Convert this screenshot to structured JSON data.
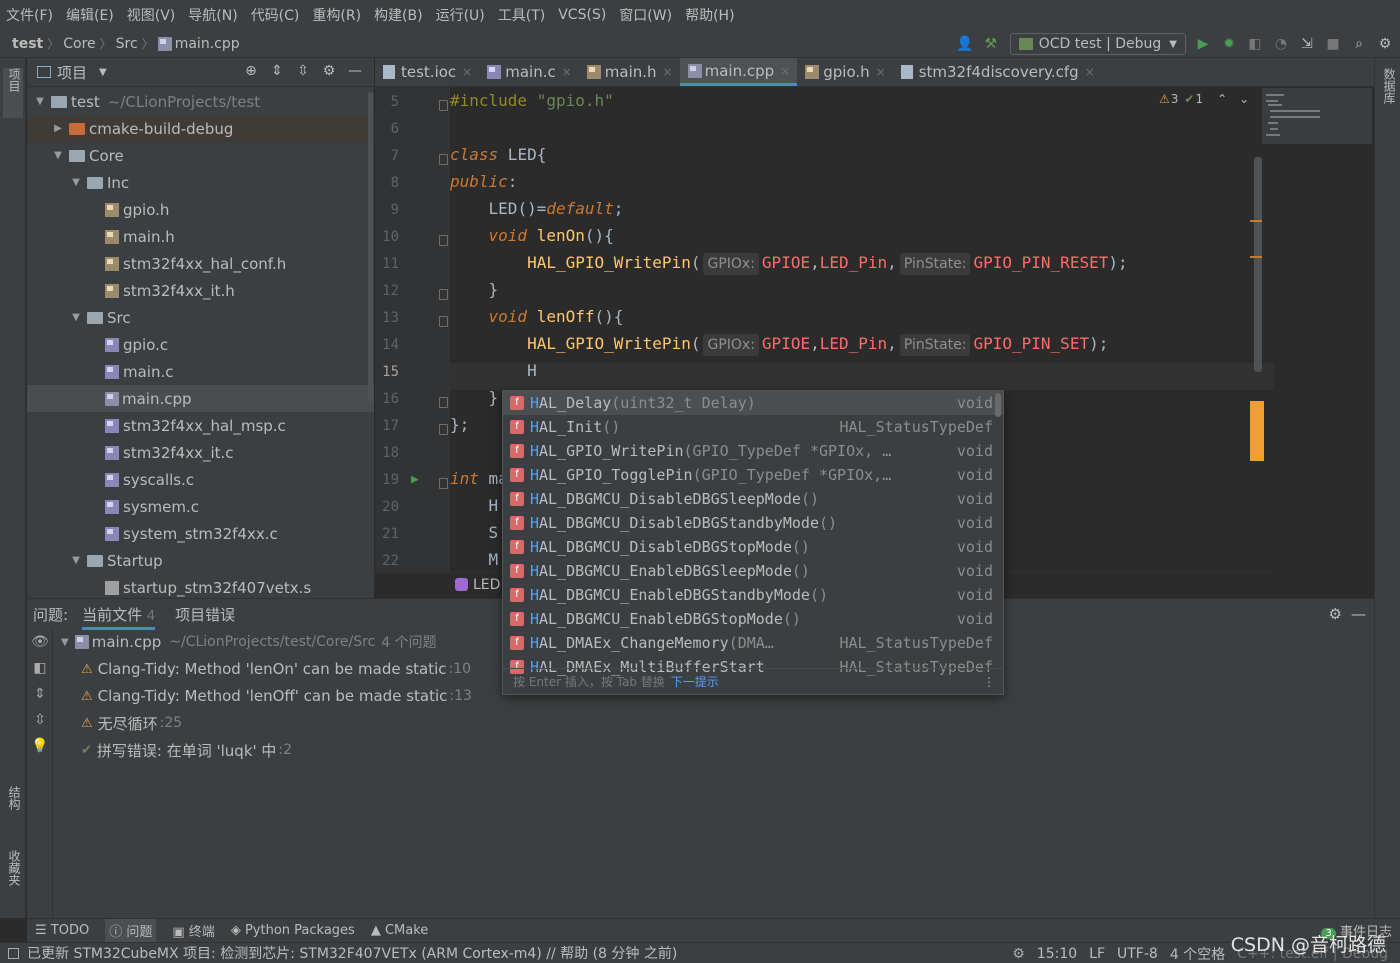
{
  "menu": [
    "文件(F)",
    "编辑(E)",
    "视图(V)",
    "导航(N)",
    "代码(C)",
    "重构(R)",
    "构建(B)",
    "运行(U)",
    "工具(T)",
    "VCS(S)",
    "窗口(W)",
    "帮助(H)"
  ],
  "breadcrumb": [
    "test",
    "Core",
    "Src",
    "main.cpp"
  ],
  "run_config": "OCD test | Debug",
  "left_tabs": [
    "项目",
    "结构",
    "收藏夹"
  ],
  "right_tabs": [
    "数据库"
  ],
  "project_panel": {
    "title": "项目",
    "tree": [
      {
        "label": "test",
        "path": "~/CLionProjects/test",
        "indent": 0,
        "arrow": "▼",
        "icon": "folder"
      },
      {
        "label": "cmake-build-debug",
        "indent": 1,
        "arrow": "▶",
        "icon": "folder-orange"
      },
      {
        "label": "Core",
        "indent": 1,
        "arrow": "▼",
        "icon": "folder"
      },
      {
        "label": "Inc",
        "indent": 2,
        "arrow": "▼",
        "icon": "folder"
      },
      {
        "label": "gpio.h",
        "indent": 3,
        "icon": "h"
      },
      {
        "label": "main.h",
        "indent": 3,
        "icon": "h"
      },
      {
        "label": "stm32f4xx_hal_conf.h",
        "indent": 3,
        "icon": "h"
      },
      {
        "label": "stm32f4xx_it.h",
        "indent": 3,
        "icon": "h"
      },
      {
        "label": "Src",
        "indent": 2,
        "arrow": "▼",
        "icon": "folder"
      },
      {
        "label": "gpio.c",
        "indent": 3,
        "icon": "c"
      },
      {
        "label": "main.c",
        "indent": 3,
        "icon": "c"
      },
      {
        "label": "main.cpp",
        "indent": 3,
        "icon": "cpp"
      },
      {
        "label": "stm32f4xx_hal_msp.c",
        "indent": 3,
        "icon": "c"
      },
      {
        "label": "stm32f4xx_it.c",
        "indent": 3,
        "icon": "c"
      },
      {
        "label": "syscalls.c",
        "indent": 3,
        "icon": "c"
      },
      {
        "label": "sysmem.c",
        "indent": 3,
        "icon": "c"
      },
      {
        "label": "system_stm32f4xx.c",
        "indent": 3,
        "icon": "c"
      },
      {
        "label": "Startup",
        "indent": 2,
        "arrow": "▼",
        "icon": "folder"
      },
      {
        "label": "startup_stm32f407vetx.s",
        "indent": 3,
        "icon": "s"
      }
    ]
  },
  "tabs": [
    {
      "label": "test.ioc",
      "icon": "cfg"
    },
    {
      "label": "main.c",
      "icon": "c"
    },
    {
      "label": "main.h",
      "icon": "h"
    },
    {
      "label": "main.cpp",
      "icon": "cpp",
      "active": true
    },
    {
      "label": "gpio.h",
      "icon": "h"
    },
    {
      "label": "stm32f4discovery.cfg",
      "icon": "cfg"
    }
  ],
  "editor": {
    "line_numbers": [
      "5",
      "6",
      "7",
      "8",
      "9",
      "10",
      "11",
      "12",
      "13",
      "14",
      "15",
      "16",
      "17",
      "18",
      "19",
      "20",
      "21",
      "22"
    ],
    "lines": {
      "l5_kw": "#include",
      "l5_str": "\"gpio.h\"",
      "l7_kw": "class",
      "l7_rest": " LED{",
      "l8_kw": "public",
      "l9_a": "LED",
      "l9_b": "()=",
      "l9_kw": "default",
      "l10_kw": "void",
      "l10_fn": "lenOn",
      "l11_fn": "HAL_GPIO_WritePin",
      "l11_h1": "GPIOx:",
      "l11_a1": "GPIOE",
      "l11_a2": "LED_Pin",
      "l11_h2": "PinState:",
      "l11_a3": "GPIO_PIN_RESET",
      "l13_kw": "void",
      "l13_fn": "lenOff",
      "l14_fn": "HAL_GPIO_WritePin",
      "l14_h1": "GPIOx:",
      "l14_a1": "GPIOE",
      "l14_a2": "LED_Pin",
      "l14_h2": "PinState:",
      "l14_a3": "GPIO_PIN_SET",
      "l15_text": "H",
      "l19_kw": "int"
    },
    "breadcrumb_label": "LED",
    "inspections": {
      "warnings": "3",
      "typos": "1"
    }
  },
  "completion": {
    "items": [
      {
        "name": "HAL_Delay",
        "sig": "(uint32_t Delay)",
        "ret": "void"
      },
      {
        "name": "HAL_Init",
        "sig": "()",
        "ret": "HAL_StatusTypeDef"
      },
      {
        "name": "HAL_GPIO_WritePin",
        "sig": "(GPIO_TypeDef *GPIOx, …",
        "ret": "void"
      },
      {
        "name": "HAL_GPIO_TogglePin",
        "sig": "(GPIO_TypeDef *GPIOx,…",
        "ret": "void"
      },
      {
        "name": "HAL_DBGMCU_DisableDBGSleepMode",
        "sig": "()",
        "ret": "void"
      },
      {
        "name": "HAL_DBGMCU_DisableDBGStandbyMode",
        "sig": "()",
        "ret": "void"
      },
      {
        "name": "HAL_DBGMCU_DisableDBGStopMode",
        "sig": "()",
        "ret": "void"
      },
      {
        "name": "HAL_DBGMCU_EnableDBGSleepMode",
        "sig": "()",
        "ret": "void"
      },
      {
        "name": "HAL_DBGMCU_EnableDBGStandbyMode",
        "sig": "()",
        "ret": "void"
      },
      {
        "name": "HAL_DBGMCU_EnableDBGStopMode",
        "sig": "()",
        "ret": "void"
      },
      {
        "name": "HAL_DMAEx_ChangeMemory",
        "sig": "(DMA…",
        "ret": "HAL_StatusTypeDef"
      },
      {
        "name": "HAL_DMAEx_MultiBufferStart",
        "sig": "",
        "ret": "HAL_StatusTypeDef"
      }
    ],
    "footer": "按 Enter 插入，按 Tab 替换",
    "footer_link": "下一提示"
  },
  "problems": {
    "label": "问题:",
    "tabs": [
      {
        "label": "当前文件",
        "count": "4",
        "active": true
      },
      {
        "label": "项目错误"
      }
    ],
    "file": "main.cpp",
    "file_path": "~/CLionProjects/test/Core/Src",
    "file_count": "4 个问题",
    "items": [
      {
        "type": "warn",
        "text": "Clang-Tidy: Method 'lenOn' can be made static",
        "loc": ":10"
      },
      {
        "type": "warn",
        "text": "Clang-Tidy: Method 'lenOff' can be made static",
        "loc": ":13"
      },
      {
        "type": "warn",
        "text": "无尽循环",
        "loc": ":25"
      },
      {
        "type": "typo",
        "text": "拼写错误: 在单词 'luqk' 中",
        "loc": ":2"
      }
    ]
  },
  "tool_tabs": [
    "TODO",
    "问题",
    "终端",
    "Python Packages",
    "CMake"
  ],
  "event_log": {
    "label": "事件日志",
    "badge": "3"
  },
  "status": {
    "message": "已更新 STM32CubeMX 项目: 检测到芯片: STM32F407VETx (ARM Cortex-m4) // 帮助 (8 分钟 之前)",
    "position": "15:10",
    "line_sep": "LF",
    "encoding": "UTF-8",
    "indent": "4 个空格",
    "context": "C++: test.elf | Debug"
  },
  "watermark": "CSDN @音柯路德"
}
